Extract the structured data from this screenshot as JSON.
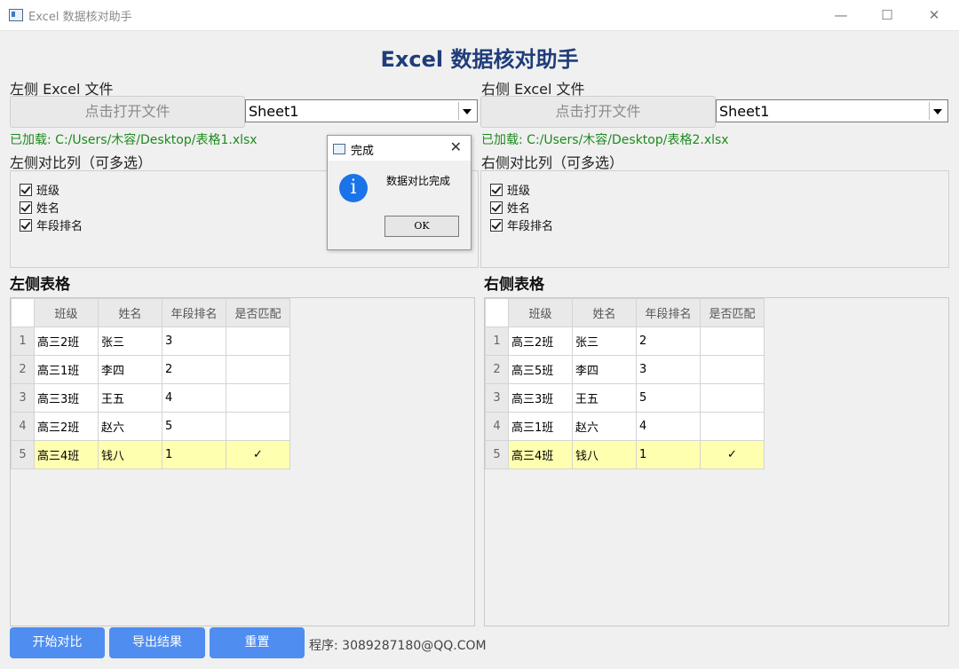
{
  "window": {
    "title": "Excel 数据核对助手",
    "minimize": "—",
    "maximize": "☐",
    "close": "✕"
  },
  "main_title": "Excel 数据核对助手",
  "left": {
    "file_label": "左侧 Excel 文件",
    "open_button": "点击打开文件",
    "sheet": "Sheet1",
    "loaded": "已加载: C:/Users/木容/Desktop/表格1.xlsx",
    "cols_label": "左侧对比列（可多选）",
    "checkboxes": [
      "班级",
      "姓名",
      "年段排名"
    ],
    "table_title": "左侧表格",
    "headers": [
      "班级",
      "姓名",
      "年段排名",
      "是否匹配"
    ],
    "rows": [
      {
        "n": "1",
        "cls": "高三2班",
        "name": "张三",
        "rank": "3",
        "match": ""
      },
      {
        "n": "2",
        "cls": "高三1班",
        "name": "李四",
        "rank": "2",
        "match": ""
      },
      {
        "n": "3",
        "cls": "高三3班",
        "name": "王五",
        "rank": "4",
        "match": ""
      },
      {
        "n": "4",
        "cls": "高三2班",
        "name": "赵六",
        "rank": "5",
        "match": ""
      },
      {
        "n": "5",
        "cls": "高三4班",
        "name": "钱八",
        "rank": "1",
        "match": "✓"
      }
    ]
  },
  "right": {
    "file_label": "右侧 Excel 文件",
    "open_button": "点击打开文件",
    "sheet": "Sheet1",
    "loaded": "已加载: C:/Users/木容/Desktop/表格2.xlsx",
    "cols_label": "右侧对比列（可多选）",
    "checkboxes": [
      "班级",
      "姓名",
      "年段排名"
    ],
    "table_title": "右侧表格",
    "headers": [
      "班级",
      "姓名",
      "年段排名",
      "是否匹配"
    ],
    "rows": [
      {
        "n": "1",
        "cls": "高三2班",
        "name": "张三",
        "rank": "2",
        "match": ""
      },
      {
        "n": "2",
        "cls": "高三5班",
        "name": "李四",
        "rank": "3",
        "match": ""
      },
      {
        "n": "3",
        "cls": "高三3班",
        "name": "王五",
        "rank": "5",
        "match": ""
      },
      {
        "n": "4",
        "cls": "高三1班",
        "name": "赵六",
        "rank": "4",
        "match": ""
      },
      {
        "n": "5",
        "cls": "高三4班",
        "name": "钱八",
        "rank": "1",
        "match": "✓"
      }
    ]
  },
  "buttons": {
    "start": "开始对比",
    "export": "导出结果",
    "reset": "重置"
  },
  "credit": "程序: 3089287180@QQ.COM",
  "dialog": {
    "title": "完成",
    "message": "数据对比完成",
    "ok": "OK",
    "info_glyph": "i",
    "close": "✕"
  },
  "colors": {
    "title": "#1f3d7a",
    "loaded": "#1d8a1d",
    "button": "#4f8ef0",
    "match_row": "#ffffb0",
    "info_icon": "#1a73e8"
  }
}
